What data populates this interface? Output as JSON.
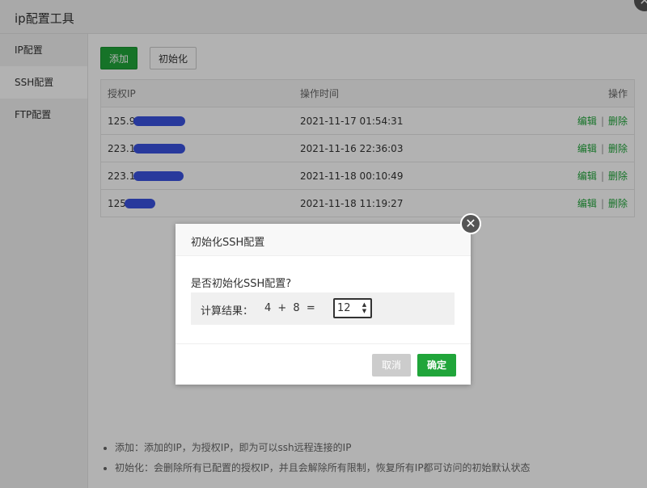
{
  "window": {
    "title": "ip配置工具",
    "close_glyph": "✕"
  },
  "sidebar": {
    "items": [
      {
        "label": "IP配置"
      },
      {
        "label": "SSH配置",
        "active": true
      },
      {
        "label": "FTP配置"
      }
    ]
  },
  "toolbar": {
    "add_label": "添加",
    "init_label": "初始化"
  },
  "table": {
    "headers": {
      "ip": "授权IP",
      "time": "操作时间",
      "ops": "操作"
    },
    "rows": [
      {
        "ip": "125.9",
        "time": "2021-11-17 01:54:31",
        "edit": "编辑",
        "sep": "|",
        "delete": "删除"
      },
      {
        "ip": "223.1",
        "time": "2021-11-16 22:36:03",
        "edit": "编辑",
        "sep": "|",
        "delete": "删除"
      },
      {
        "ip": "223.1",
        "time": "2021-11-18 00:10:49",
        "edit": "编辑",
        "sep": "|",
        "delete": "删除"
      },
      {
        "ip": "125",
        "time": "2021-11-18 11:19:27",
        "edit": "编辑",
        "sep": "|",
        "delete": "删除"
      }
    ]
  },
  "notes": [
    "添加：添加的IP，为授权IP，即为可以ssh远程连接的IP",
    "初始化：会删除所有已配置的授权IP，并且会解除所有限制，恢复所有IP都可访问的初始默认状态"
  ],
  "modal": {
    "title": "初始化SSH配置",
    "close_glyph": "✕",
    "question": "是否初始化SSH配置?",
    "calc_label": "计算结果：",
    "calc_expr": "4 + 8  =",
    "calc_value": "12",
    "spin_up": "▲",
    "spin_down": "▼",
    "cancel_label": "取消",
    "ok_label": "确定"
  },
  "colors": {
    "accent": "#20a53a",
    "mask": "#3a52e0"
  }
}
